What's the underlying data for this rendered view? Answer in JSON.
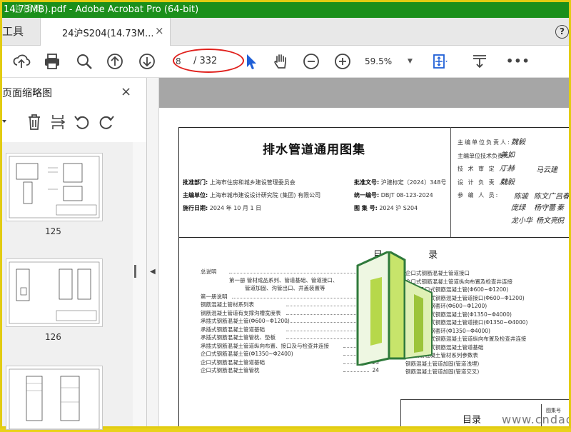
{
  "window": {
    "title": "14.73MB).pdf - Adobe Acrobat Pro (64-bit)",
    "watermark": "道桥网"
  },
  "tabbar": {
    "tools_label": "工具",
    "tab_label": "24沪S204(14.73M...",
    "close": "×",
    "help": "?"
  },
  "toolbar": {
    "icons": [
      "upload-icon",
      "print-icon",
      "search-icon",
      "prev-page-icon",
      "next-page-icon",
      "cursor-icon",
      "hand-icon",
      "zoom-out-icon",
      "zoom-in-icon",
      "fit-page-icon",
      "scroll-mode-icon",
      "more-icon"
    ],
    "page_current": "8",
    "page_total": "/ 332",
    "zoom": "59.5%",
    "more": "•••"
  },
  "thumbnails": {
    "title": "页面缩略图",
    "close": "×",
    "pages": [
      "125",
      "126"
    ]
  },
  "document": {
    "title": "排水管道通用图集",
    "approval_dept_label": "批准部门:",
    "approval_dept": "上海市住房和城乡建设管理委员会",
    "editor_label": "主编单位:",
    "editor": "上海市城市建设设计研究院 (集团) 有限公司",
    "effective_label": "施行日期:",
    "effective": "2024 年 10 月 1 日",
    "approval_no_label": "批准文号:",
    "approval_no": "沪建标定〔2024〕348号",
    "serial_label": "统一编号:",
    "serial": "DBJT 08-123-2024",
    "atlas_label": "图 集 号:",
    "atlas": "2024 沪 S204",
    "persons": [
      "主编单位负责人:",
      "主编单位技术负责人:",
      "技 术 审 定 人:",
      "设 计 负 责 人:",
      "参   编   人   员:"
    ],
    "signatures": [
      "魏毅",
      "美如",
      "丁赫",
      "马云建",
      "魏毅",
      "陈骏",
      "陈文广",
      "吕春",
      "庞绿",
      "杨守蕾",
      "秦",
      "龙小华",
      "杨文亮",
      "倪"
    ],
    "toc_title": "目 录",
    "toc_left": [
      {
        "text": "总说明",
        "num": "5"
      },
      {
        "text": "第一册  管材成品系列、管道基础、管道接口、",
        "num": ""
      },
      {
        "text": "管道加固、沟管出口、井盖装置等",
        "num": ""
      },
      {
        "text": "第一册说明",
        "num": "9"
      },
      {
        "text": "钢筋混凝土管材系列表",
        "num": "16"
      },
      {
        "text": "钢筋混凝土管道有支撑沟槽宽度表",
        "num": "17"
      },
      {
        "text": "承插式钢筋混凝土管(Φ600~Φ1200)",
        "num": "18"
      },
      {
        "text": "承插式钢筋混凝土管道基础",
        "num": "19"
      },
      {
        "text": "承插式钢筋混凝土管管枕、垫板",
        "num": "20"
      },
      {
        "text": "承插式钢筋混凝土管道纵向布置、接口及与检查井连接",
        "num": "21"
      },
      {
        "text": "企口式钢筋混凝土管(Φ1350~Φ2400)",
        "num": "22"
      },
      {
        "text": "企口式钢筋混凝土管道基础",
        "num": "23"
      },
      {
        "text": "企口式钢筋混凝土管管枕",
        "num": "24"
      }
    ],
    "toc_right": [
      "企口式钢筋混凝土管道接口",
      "企口式钢筋混凝土管道纵向布置及检查井连接",
      "F型钢承口式钢筋混凝土管(Φ600~Φ1200)",
      "F型钢承口式钢筋混凝土管道接口(Φ600~Φ1200)",
      "F型钢承口钢套环(Φ600~Φ1200)",
      "F型钢承口式钢筋混凝土管(Φ1350~Φ4000)",
      "F型钢承口式钢筋混凝土管道接口(Φ1350~Φ4000)",
      "F型钢承口钢套环(Φ1350~Φ4000)",
      "F型钢承口式钢筋混凝土管道纵向布置及检查井连接",
      "F型钢承口式钢筋混凝土管道基础",
      "F型钢筋混凝土管材系列参数表",
      "钢筋混凝土管道加固(管道浅埋)",
      "钢筋混凝土管道加固(管道交叉)"
    ],
    "footer_label": "目录",
    "footer_tiny": "图集号",
    "site_watermark": "www.cndao.com"
  },
  "colors": {
    "titlebar": "#1b8f1b",
    "frame": "#e2cc12",
    "annotation_circle": "#e0201c",
    "cursor": "#1f5fd6"
  }
}
